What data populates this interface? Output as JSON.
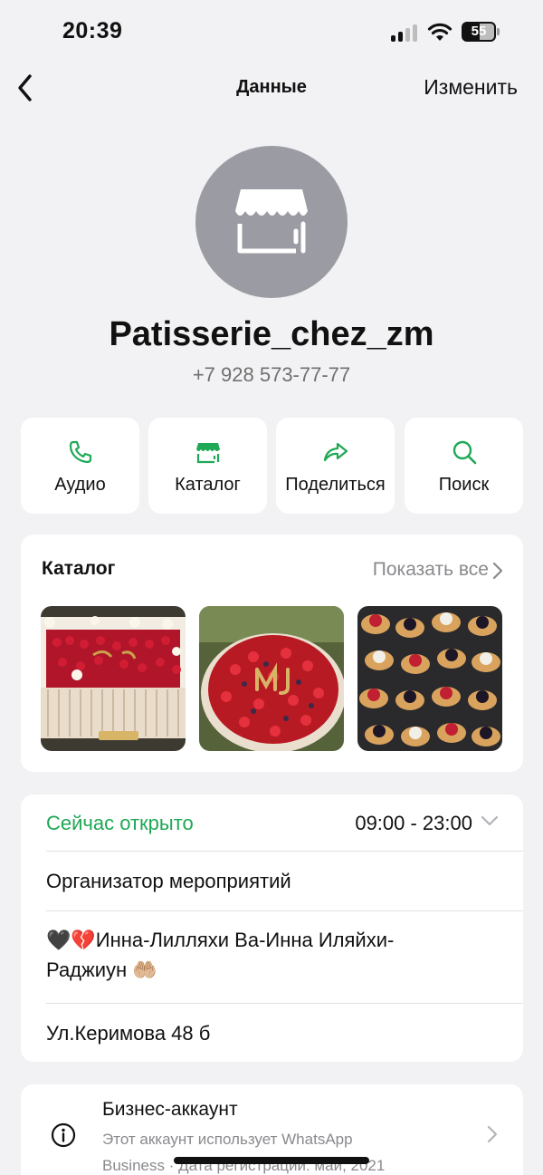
{
  "status_bar": {
    "time": "20:39",
    "battery": "55"
  },
  "nav": {
    "title": "Данные",
    "edit_label": "Изменить",
    "back_icon": "chevron-left-icon"
  },
  "profile": {
    "name": "Patisserie_chez_zm",
    "phone": "+7 928 573-77-77",
    "avatar_icon": "storefront-icon"
  },
  "actions": [
    {
      "label": "Аудио",
      "icon": "phone-icon"
    },
    {
      "label": "Каталог",
      "icon": "storefront-icon"
    },
    {
      "label": "Поделиться",
      "icon": "share-arrow-icon"
    },
    {
      "label": "Поиск",
      "icon": "search-icon"
    }
  ],
  "catalog": {
    "title": "Каталог",
    "show_all": "Показать все",
    "items": [
      "cake-strawberry-image",
      "berry-tart-image",
      "berry-tartlets-image"
    ]
  },
  "info": {
    "open_status": "Сейчас открыто",
    "hours": "09:00 - 23:00",
    "category": "Организатор мероприятий",
    "description_line1": "🖤💔Инна-Лилляхи Ва-Инна Иляйхи-",
    "description_line2": "Раджиун 🤲🏼",
    "address": "Ул.Керимова 48 б"
  },
  "business": {
    "title": "Бизнес-аккаунт",
    "description_line1": "Этот аккаунт использует WhatsApp",
    "description_line2": "Business · Дата регистрации: май, 2021"
  },
  "colors": {
    "accent_green": "#1fa855",
    "background": "#f2f2f4",
    "avatar_gray": "#9b9ba3"
  }
}
